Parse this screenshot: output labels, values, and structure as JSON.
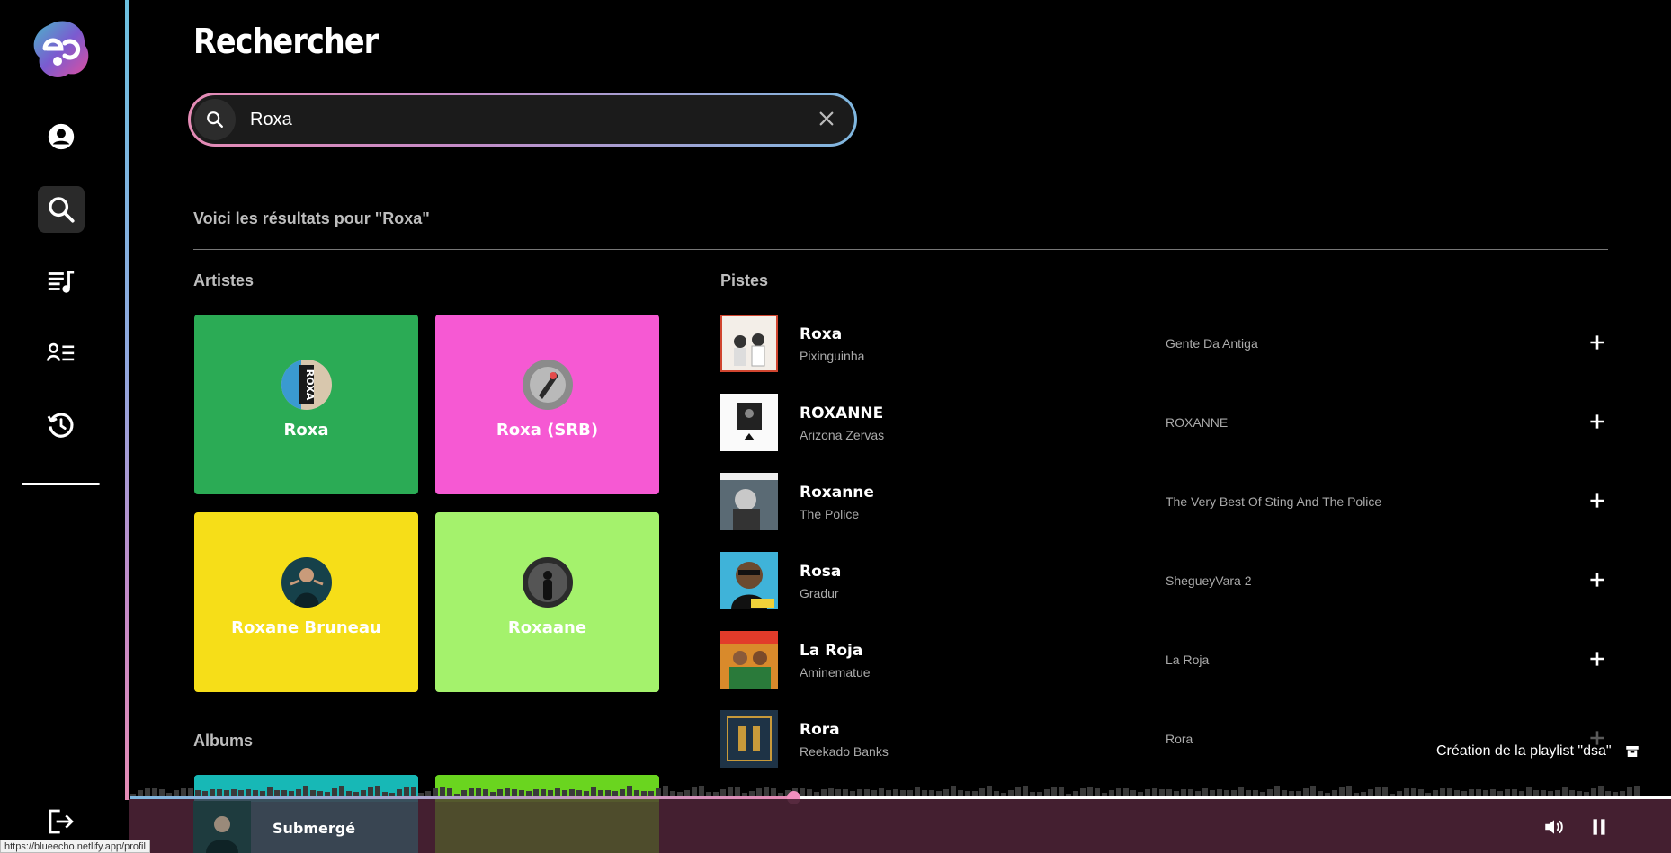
{
  "page": {
    "title": "Rechercher",
    "results_heading": "Voici les résultats pour \"Roxa\""
  },
  "search": {
    "value": "Roxa",
    "placeholder": ""
  },
  "sections": {
    "artists": "Artistes",
    "tracks": "Pistes",
    "albums": "Albums"
  },
  "artists": [
    {
      "name": "Roxa",
      "color": "#2bab55"
    },
    {
      "name": "Roxa (SRB)",
      "color": "#f659d3"
    },
    {
      "name": "Roxane Bruneau",
      "color": "#f6de18"
    },
    {
      "name": "Roxaane",
      "color": "#a4f26c"
    }
  ],
  "tracks": [
    {
      "title": "Roxa",
      "artist": "Pixinguinha",
      "album": "Gente Da Antiga"
    },
    {
      "title": "ROXANNE",
      "artist": "Arizona Zervas",
      "album": "ROXANNE"
    },
    {
      "title": "Roxanne",
      "artist": "The Police",
      "album": "The Very Best Of Sting And The Police"
    },
    {
      "title": "Rosa",
      "artist": "Gradur",
      "album": "SheguеyVara 2"
    },
    {
      "title": "La Roja",
      "artist": "Aminematue",
      "album": "La Roja"
    },
    {
      "title": "Rora",
      "artist": "Reekado Banks",
      "album": "Rora"
    }
  ],
  "album_colors": [
    "#17b8b6",
    "#6ad51f"
  ],
  "player": {
    "now_playing": "Submergé",
    "progress": 0.43
  },
  "toast": {
    "message": "Création de la playlist \"dsa\""
  },
  "status_bar": {
    "url": "https://blueecho.netlify.app/profil"
  }
}
